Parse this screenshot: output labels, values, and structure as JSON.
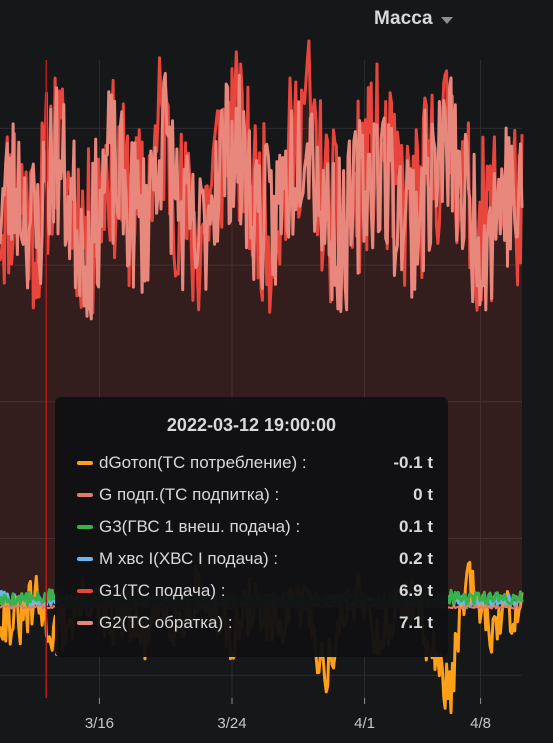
{
  "panel": {
    "title": "Масса"
  },
  "tooltip": {
    "time": "2022-03-12 19:00:00",
    "rows": [
      {
        "name": "dGотоп(ТС потребление) :",
        "value": "-0.1 t",
        "color": "#ff9f1a"
      },
      {
        "name": "G подп.(ТС подпитка) :",
        "value": "0 t",
        "color": "#e07b6e"
      },
      {
        "name": "G3(ГВС 1 внеш. подача) :",
        "value": "0.1 t",
        "color": "#37b24d"
      },
      {
        "name": "М хвс I(ХВС I подача) :",
        "value": "0.2 t",
        "color": "#6ab8ea"
      },
      {
        "name": "G1(ТС подача) :",
        "value": "6.9 t",
        "color": "#e8453c"
      },
      {
        "name": "G2(ТС обратка) :",
        "value": "7.1 t",
        "color": "#e8877c"
      }
    ]
  },
  "chart_data": {
    "type": "line",
    "x_tick_labels": [
      "3/16",
      "3/24",
      "4/1",
      "4/8"
    ],
    "y_range": [
      -1.6,
      9.6
    ],
    "grid": true,
    "x_start": "2022-03-10 00:00",
    "x_end": "2022-04-10 12:00",
    "series": [
      {
        "name": "G1(ТС подача)",
        "color": "#e8453c",
        "fill": true,
        "mean": 7.1,
        "amplitude": 1.0,
        "seed": 11,
        "values": [
          6.9,
          7.5,
          6.6,
          8.2,
          7.1,
          6.4,
          7.9,
          7.2,
          6.8,
          8.6,
          7.0,
          6.3,
          7.8,
          8.4,
          7.3,
          6.7,
          7.6,
          8.9,
          7.1,
          6.5,
          7.4,
          8.0,
          7.2,
          6.9,
          7.7,
          8.3,
          7.0,
          6.6,
          7.5,
          6.9
        ]
      },
      {
        "name": "G2(ТС обратка)",
        "color": "#e8877c",
        "fill": false,
        "mean": 7.0,
        "amplitude": 0.9,
        "seed": 23,
        "values": [
          7.1,
          7.4,
          6.5,
          8.0,
          7.0,
          6.3,
          7.8,
          7.1,
          6.7,
          8.4,
          6.9,
          6.2,
          7.7,
          8.2,
          7.2,
          6.6,
          7.5,
          8.7,
          7.0,
          6.4,
          7.3,
          7.9,
          7.1,
          6.8,
          7.6,
          8.1,
          6.9,
          6.5,
          7.4,
          6.8
        ]
      },
      {
        "name": "G3(ГВС 1 внеш. подача)",
        "color": "#37b24d",
        "fill": false,
        "mean": 0.15,
        "amplitude": 0.08,
        "seed": 5,
        "values": [
          0.1,
          0.15,
          0.12,
          0.2,
          0.1,
          0.14,
          0.18,
          0.1,
          0.16,
          0.12,
          0.15,
          0.1,
          0.19,
          0.13,
          0.1,
          0.17,
          0.12,
          0.15,
          0.1,
          0.14,
          0.18,
          0.11,
          0.16,
          0.2,
          0.13,
          0.17,
          0.1,
          0.15,
          0.12,
          0.18
        ]
      },
      {
        "name": "М хвс I(ХВС I подача)",
        "color": "#6ab8ea",
        "fill": false,
        "mean": 0.1,
        "amplitude": 0.06,
        "seed": 7,
        "values": [
          0.2,
          0.1,
          0.08,
          0.12,
          0.1,
          0.09,
          0.11,
          0.1,
          0.08,
          0.12,
          0.1,
          0.09,
          0.1,
          0.11,
          0.1,
          0.08,
          0.12,
          0.1,
          0.09,
          0.11,
          0.1,
          0.08,
          0.12,
          0.1,
          0.09,
          0.11,
          0.1,
          0.08,
          0.12,
          0.1
        ]
      },
      {
        "name": "dGотоп(ТС потребление)",
        "color": "#ff9f1a",
        "fill": false,
        "mean": -0.1,
        "amplitude": 0.3,
        "seed": 31,
        "values": [
          -0.1,
          -0.3,
          0.1,
          -0.5,
          -0.2,
          0.2,
          -0.4,
          -0.1,
          -0.6,
          0.0,
          -0.3,
          0.3,
          -0.2,
          -0.5,
          0.1,
          -0.4,
          -0.2,
          0.2,
          -1.2,
          -0.3,
          0.4,
          -0.6,
          -0.1,
          0.2,
          -0.8,
          -1.5,
          0.5,
          -0.4,
          -0.2,
          0.1
        ]
      },
      {
        "name": "G подп.(ТС подпитка)",
        "color": "#e07b6e",
        "fill": false,
        "mean": 0.0,
        "amplitude": 0.02,
        "seed": 3,
        "values": [
          0,
          0,
          0,
          0,
          0,
          0,
          0,
          0,
          0,
          0,
          0,
          0,
          0,
          0,
          0,
          0,
          0,
          0,
          0,
          0,
          0,
          0,
          0,
          0,
          0,
          0,
          0,
          0,
          0,
          0
        ]
      }
    ],
    "annotation_time": "2022-03-12 19:00:00"
  }
}
